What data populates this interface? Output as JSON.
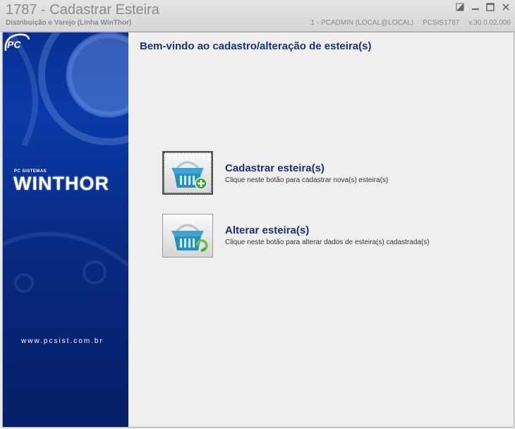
{
  "window": {
    "title": "1787 - Cadastrar Esteira",
    "subtitle": "Distribuição e Varejo (Linha WinThor)",
    "user": "1 - PCADMIN (LOCAL@LOCAL)",
    "program": "PCSIS1787",
    "version": "v.30.0.02.006"
  },
  "sidebar": {
    "brand_small": "PC SISTEMAS",
    "brand": "WINTHOR",
    "pc_logo_text": "PC",
    "website": "www.pcsist.com.br"
  },
  "main": {
    "welcome": "Bem-vindo ao cadastro/alteração de esteira(s)",
    "options": [
      {
        "title": "Cadastrar esteira(s)",
        "description": "Clique neste botão para cadastrar nova(s) esteira(s)",
        "icon": "basket-add-icon"
      },
      {
        "title": "Alterar esteira(s)",
        "description": "Clique neste botão para alterar dados de esteira(s) cadastrada(s)",
        "icon": "basket-refresh-icon"
      }
    ]
  },
  "colors": {
    "accent": "#1b2f7c",
    "sidebar": "#0b3aa8",
    "add_badge": "#3aa635",
    "refresh_badge": "#6cc04a",
    "basket": "#2a8fbf"
  }
}
